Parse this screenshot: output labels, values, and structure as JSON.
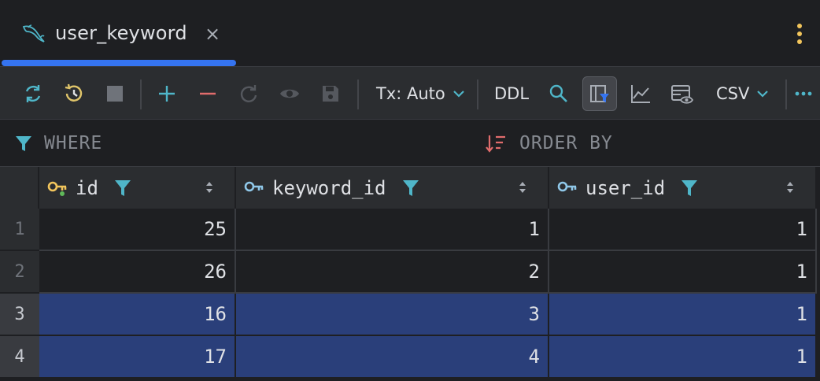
{
  "tab": {
    "title": "user_keyword",
    "close": "×"
  },
  "toolbar": {
    "tx_mode": "Tx: Auto",
    "ddl": "DDL",
    "export_format": "CSV",
    "colors": {
      "refresh": "#4fb6c9",
      "add": "#4fb6c9",
      "remove": "#e06c6c",
      "accent": "#3574f0"
    }
  },
  "filters": {
    "where": "WHERE",
    "order_by": "ORDER BY"
  },
  "table": {
    "columns": [
      "id",
      "keyword_id",
      "user_id"
    ],
    "rows": [
      {
        "num": "1",
        "id": "25",
        "keyword_id": "1",
        "user_id": "1",
        "selected": false
      },
      {
        "num": "2",
        "id": "26",
        "keyword_id": "2",
        "user_id": "1",
        "selected": false
      },
      {
        "num": "3",
        "id": "16",
        "keyword_id": "3",
        "user_id": "1",
        "selected": true
      },
      {
        "num": "4",
        "id": "17",
        "keyword_id": "4",
        "user_id": "1",
        "selected": true
      }
    ]
  }
}
